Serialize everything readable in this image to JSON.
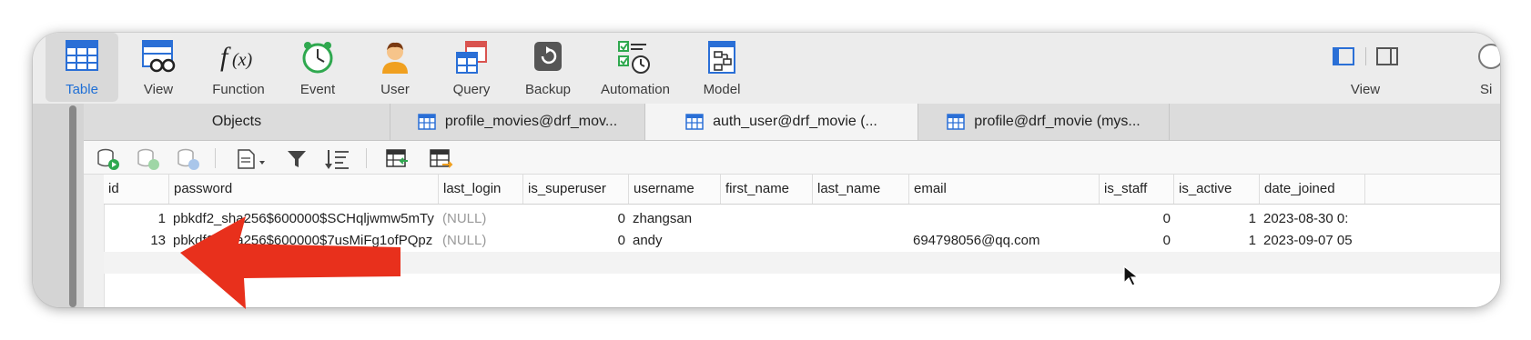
{
  "toolbar": {
    "items": [
      {
        "label": "Table",
        "icon": "table-icon",
        "active": true
      },
      {
        "label": "View",
        "icon": "view-icon"
      },
      {
        "label": "Function",
        "icon": "function-icon"
      },
      {
        "label": "Event",
        "icon": "clock-icon"
      },
      {
        "label": "User",
        "icon": "user-icon"
      },
      {
        "label": "Query",
        "icon": "query-icon"
      },
      {
        "label": "Backup",
        "icon": "backup-icon"
      },
      {
        "label": "Automation",
        "icon": "automation-icon"
      },
      {
        "label": "Model",
        "icon": "model-icon"
      }
    ],
    "right": {
      "view_label": "View",
      "si_label": "Si"
    },
    "accent": "#1f6fd6"
  },
  "tabs": [
    {
      "label": "Objects"
    },
    {
      "label": "profile_movies@drf_mov..."
    },
    {
      "label": "auth_user@drf_movie (...",
      "active": true
    },
    {
      "label": "profile@drf_movie (mys..."
    }
  ],
  "table": {
    "columns": [
      "id",
      "password",
      "last_login",
      "is_superuser",
      "username",
      "first_name",
      "last_name",
      "email",
      "is_staff",
      "is_active",
      "date_joined"
    ],
    "rows": [
      [
        "1",
        "pbkdf2_sha256$600000$SCHqljwmw5mTy",
        "(NULL)",
        "0",
        "zhangsan",
        "",
        "",
        "",
        "0",
        "1",
        "2023-08-30 0:"
      ],
      [
        "13",
        "pbkdf2_sha256$600000$7usMiFg1ofPQpz",
        "(NULL)",
        "0",
        "andy",
        "",
        "",
        "694798056@qq.com",
        "0",
        "1",
        "2023-09-07 05"
      ]
    ]
  },
  "colors": {
    "annotation_arrow": "#e8301c"
  }
}
